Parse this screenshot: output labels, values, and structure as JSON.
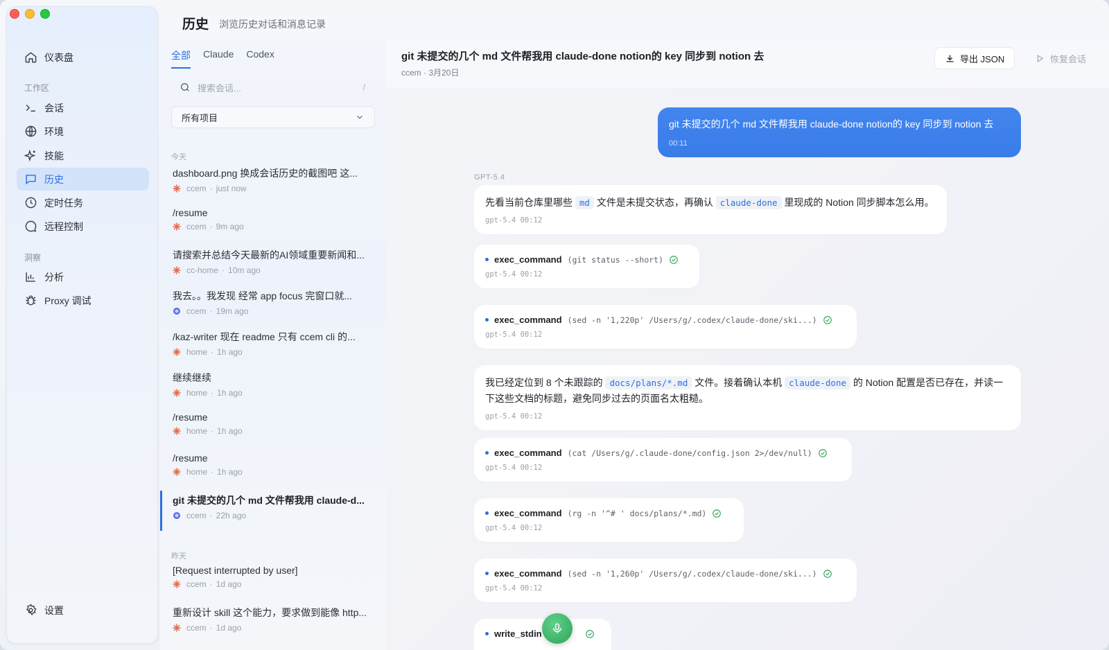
{
  "sidebar": {
    "items": [
      {
        "label": "仪表盘",
        "icon": "home-icon"
      },
      {
        "label": "会话",
        "icon": "terminal-icon"
      },
      {
        "label": "环境",
        "icon": "globe-icon"
      },
      {
        "label": "技能",
        "icon": "sparkle-icon"
      },
      {
        "label": "历史",
        "icon": "chat-bubble-icon"
      },
      {
        "label": "定时任务",
        "icon": "clock-icon"
      },
      {
        "label": "远程控制",
        "icon": "message-circle-icon"
      },
      {
        "label": "分析",
        "icon": "bar-chart-icon"
      },
      {
        "label": "Proxy 调试",
        "icon": "bug-icon"
      }
    ],
    "sections": {
      "workspace": "工作区",
      "insights": "洞察"
    },
    "settings_label": "设置",
    "active_index": 4
  },
  "header": {
    "title": "历史",
    "subtitle": "浏览历史对话和消息记录"
  },
  "list": {
    "tabs": [
      "全部",
      "Claude",
      "Codex"
    ],
    "search_placeholder": "搜索会话...",
    "search_shortcut": "/",
    "project_select": "所有项目",
    "group_today": "今天",
    "group_yesterday": "昨天",
    "conversations": [
      {
        "title": "dashboard.png 换成会话历史的截图吧 这...",
        "project": "ccem",
        "time": "just now",
        "source": "claude"
      },
      {
        "title": "/resume",
        "project": "ccem",
        "time": "9m ago",
        "source": "claude"
      },
      {
        "title": "请搜索并总结今天最新的AI领域重要新闻和...",
        "project": "cc-home",
        "time": "10m ago",
        "source": "claude"
      },
      {
        "title": "我去。。我发现 经常 app focus 完窗口就...",
        "project": "ccem",
        "time": "19m ago",
        "source": "codex"
      },
      {
        "title": "/kaz-writer 现在 readme 只有 ccem cli 的...",
        "project": "home",
        "time": "1h ago",
        "source": "claude"
      },
      {
        "title": "继续继续",
        "project": "home",
        "time": "1h ago",
        "source": "claude"
      },
      {
        "title": "/resume",
        "project": "home",
        "time": "1h ago",
        "source": "claude"
      },
      {
        "title": "/resume",
        "project": "home",
        "time": "1h ago",
        "source": "claude"
      },
      {
        "title": "git 未提交的几个 md 文件帮我用 claude-d...",
        "project": "ccem",
        "time": "22h ago",
        "source": "codex"
      },
      {
        "title": "[Request interrupted by user]",
        "project": "ccem",
        "time": "1d ago",
        "source": "claude"
      },
      {
        "title": "重新设计 skill 这个能力，要求做到能像 http...",
        "project": "ccem",
        "time": "1d ago",
        "source": "claude"
      }
    ]
  },
  "detail": {
    "title": "git 未提交的几个 md 文件帮我用 claude-done notion的 key 同步到 notion 去",
    "meta": "ccem · 3月20日",
    "export_label": "导出 JSON",
    "resume_label": "恢复会话",
    "user_message": {
      "text": "git 未提交的几个 md 文件帮我用 claude-done notion的 key 同步到 notion 去",
      "time": "00:11"
    },
    "model_label": "GPT-5.4",
    "msg1": {
      "pre": "先看当前仓库里哪些 ",
      "code1": "md",
      "mid": " 文件是未提交状态，再确认 ",
      "code2": "claude-done",
      "post": " 里现成的 Notion 同步脚本怎么用。",
      "foot": "gpt-5.4  00:12"
    },
    "tool1": {
      "name": "exec_command",
      "args": "(git status --short)",
      "foot": "gpt-5.4  00:12"
    },
    "tool2": {
      "name": "exec_command",
      "args": "(sed -n '1,220p' /Users/g/.codex/claude-done/ski...)",
      "foot": "gpt-5.4  00:12"
    },
    "msg2": {
      "pre": "我已经定位到 8 个未跟踪的 ",
      "code1": "docs/plans/*.md",
      "mid": " 文件。接着确认本机 ",
      "code2": "claude-done",
      "post": " 的 Notion 配置是否已存在，并读一下这些文档的标题，避免同步过去的页面名太粗糙。",
      "foot": "gpt-5.4  00:12"
    },
    "tool3": {
      "name": "exec_command",
      "args": "(cat /Users/g/.claude-done/config.json 2>/dev/null)",
      "foot": "gpt-5.4  00:12"
    },
    "tool4": {
      "name": "exec_command",
      "args": "(rg -n '^# ' docs/plans/*.md)",
      "foot": "gpt-5.4  00:12"
    },
    "tool5": {
      "name": "exec_command",
      "args": "(sed -n '1,260p' /Users/g/.codex/claude-done/ski...)",
      "foot": "gpt-5.4  00:12"
    },
    "tool6": {
      "name": "write_stdin"
    }
  },
  "colors": {
    "accent": "#2d6fe0",
    "user_bubble": "#3a7ce8",
    "claude": "#e06a4a",
    "codex": "#5b6cf0",
    "success": "#3aa55d"
  }
}
